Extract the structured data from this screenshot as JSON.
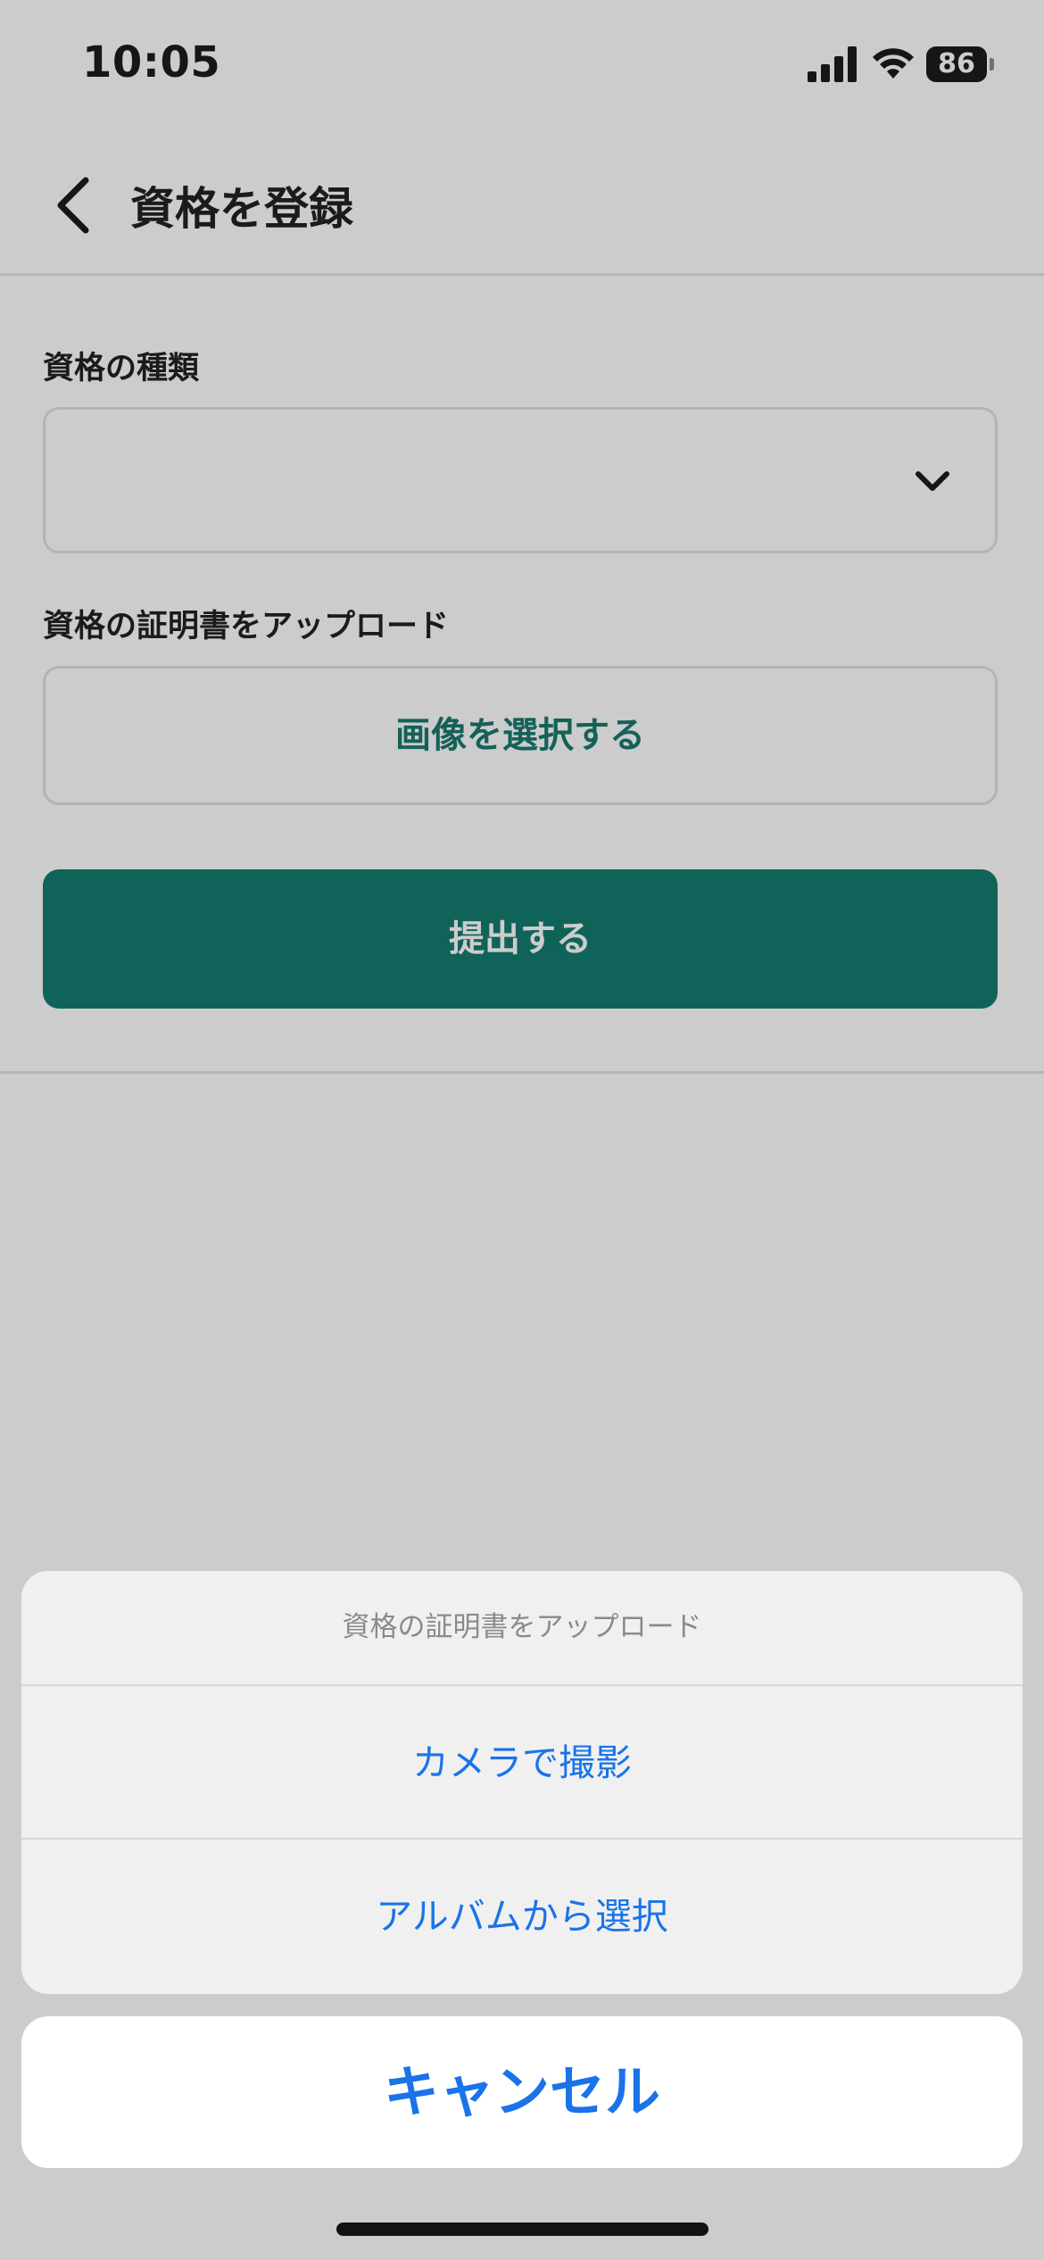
{
  "status_bar": {
    "time": "10:05",
    "battery": "86",
    "icons": [
      "signal-icon",
      "wifi-icon",
      "battery-icon"
    ]
  },
  "header": {
    "title": "資格を登録",
    "back_icon": "chevron-left-icon"
  },
  "form": {
    "type_label": "資格の種類",
    "type_value": "",
    "upload_label": "資格の証明書をアップロード",
    "image_select_label": "画像を選択する",
    "submit_label": "提出する"
  },
  "action_sheet": {
    "title": "資格の証明書をアップロード",
    "options": [
      "カメラで撮影",
      "アルバムから選択"
    ],
    "cancel_label": "キャンセル"
  },
  "colors": {
    "accent_green": "#157c70",
    "ios_blue": "#1a73e8"
  }
}
